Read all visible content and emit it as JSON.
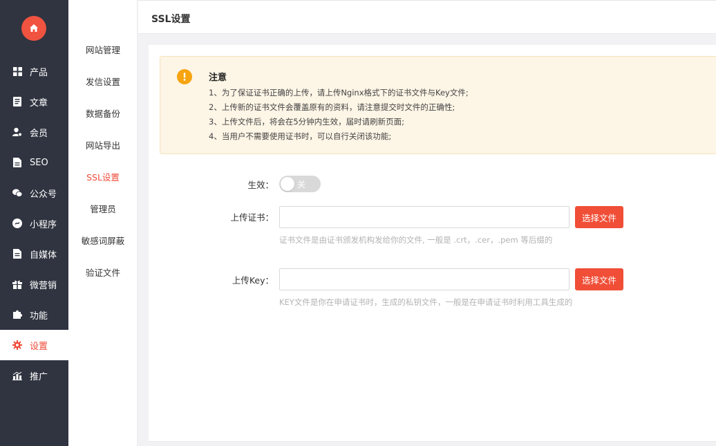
{
  "sidebar": {
    "items": [
      {
        "label": "产品",
        "icon": "grid-icon"
      },
      {
        "label": "文章",
        "icon": "document-icon"
      },
      {
        "label": "会员",
        "icon": "user-icon"
      },
      {
        "label": "SEO",
        "icon": "file-icon"
      },
      {
        "label": "公众号",
        "icon": "wechat-icon"
      },
      {
        "label": "小程序",
        "icon": "mini-program-icon"
      },
      {
        "label": "自媒体",
        "icon": "media-icon"
      },
      {
        "label": "微营销",
        "icon": "gift-icon"
      },
      {
        "label": "功能",
        "icon": "puzzle-icon"
      },
      {
        "label": "设置",
        "icon": "gear-icon"
      },
      {
        "label": "推广",
        "icon": "chart-icon"
      }
    ],
    "active": "设置"
  },
  "submenu": {
    "items": [
      "网站管理",
      "发信设置",
      "数据备份",
      "网站导出",
      "SSL设置",
      "管理员",
      "敏感词屏蔽",
      "验证文件"
    ],
    "active": "SSL设置"
  },
  "header": {
    "title": "SSL设置"
  },
  "notice": {
    "title": "注意",
    "lines": [
      "1、为了保证证书正确的上传，请上传Nginx格式下的证书文件与Key文件;",
      "2、上传新的证书文件会覆盖原有的资料，请注意提交时文件的正确性;",
      "3、上传文件后，将会在5分钟内生效，届时请刷新页面;",
      "4、当用户不需要使用证书时，可以自行关闭该功能;"
    ]
  },
  "form": {
    "enable_label": "生效：",
    "toggle_text": "关",
    "cert_label": "上传证书：",
    "cert_button": "选择文件",
    "cert_hint": "证书文件是由证书颁发机构发给你的文件, 一般是 .crt，.cer，.pem 等后缀的",
    "key_label": "上传Key：",
    "key_button": "选择文件",
    "key_hint": "KEY文件是你在申请证书时，生成的私钥文件，一般是在申请证书时利用工具生成的"
  },
  "colors": {
    "accent": "#ee4b3a",
    "sidebar": "#2f3440",
    "button": "#f04e37",
    "notice_bg": "#fdf5e6",
    "warning": "#f6a40f"
  }
}
